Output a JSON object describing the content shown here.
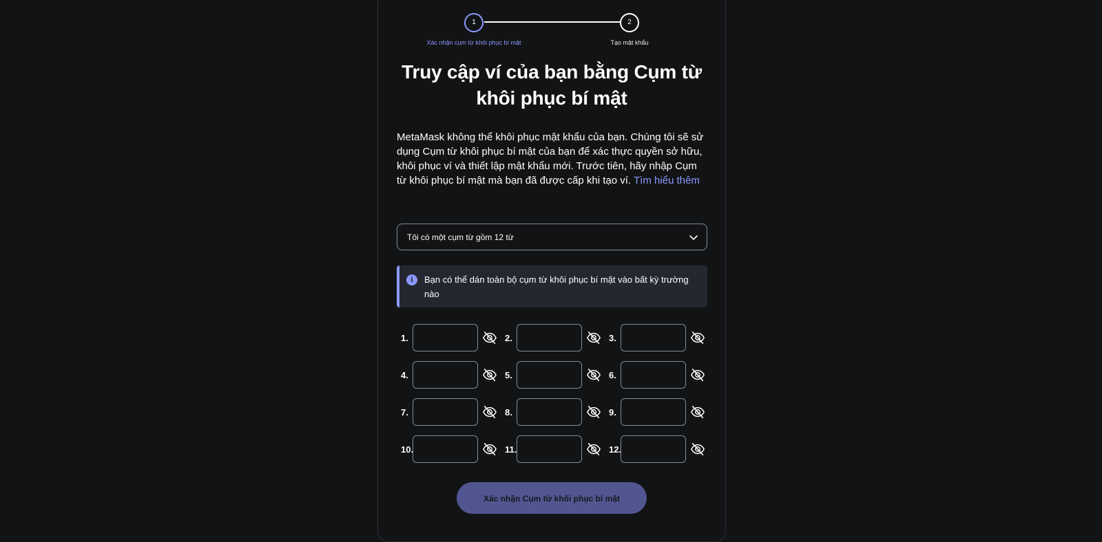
{
  "stepper": {
    "step1_number": "1",
    "step1_label": "Xác nhận cụm từ khôi phục bí mật",
    "step2_number": "2",
    "step2_label": "Tạo mật khẩu"
  },
  "title_line1": "Truy cập ví của bạn bằng Cụm từ",
  "title_line2": "khôi phục bí mật",
  "description": "MetaMask không thể khôi phục mật khẩu của bạn. Chúng tôi sẽ sử dụng Cụm từ khôi phục bí mật của bạn để xác thực quyền sở hữu, khôi phục ví và thiết lập mật khẩu mới. Trước tiên, hãy nhập Cụm từ khôi phục bí mật mà bạn đã được cấp khi tạo ví.",
  "learn_more": "Tìm hiểu thêm",
  "select": {
    "value": "Tôi có một cụm từ gồm 12 từ"
  },
  "notice": {
    "icon": "info-icon",
    "text": "Bạn có thể dán toàn bộ cụm từ khôi phục bí mật vào bất kỳ trường nào"
  },
  "words": [
    {
      "label": "1.",
      "value": ""
    },
    {
      "label": "2.",
      "value": ""
    },
    {
      "label": "3.",
      "value": ""
    },
    {
      "label": "4.",
      "value": ""
    },
    {
      "label": "5.",
      "value": ""
    },
    {
      "label": "6.",
      "value": ""
    },
    {
      "label": "7.",
      "value": ""
    },
    {
      "label": "8.",
      "value": ""
    },
    {
      "label": "9.",
      "value": ""
    },
    {
      "label": "10.",
      "value": ""
    },
    {
      "label": "11.",
      "value": ""
    },
    {
      "label": "12.",
      "value": ""
    }
  ],
  "confirm_button": "Xác nhận Cụm từ khôi phục bí mật",
  "colors": {
    "background": "#121314",
    "accent": "#8b99ff",
    "button_disabled": "#515690",
    "notice_bg": "#24272f"
  }
}
